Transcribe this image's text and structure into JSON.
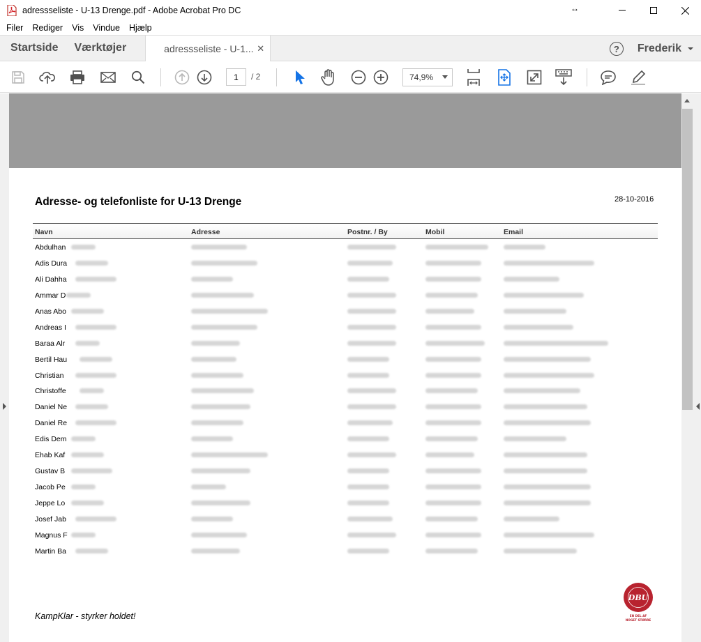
{
  "window": {
    "title": "adressseliste - U-13 Drenge.pdf - Adobe Acrobat Pro DC"
  },
  "menu": [
    "Filer",
    "Rediger",
    "Vis",
    "Vindue",
    "Hjælp"
  ],
  "tabs": {
    "home": "Startside",
    "tools": "Værktøjer",
    "document": "adressseliste - U-1...",
    "user": "Frederik"
  },
  "toolbar": {
    "page_current": "1",
    "page_total": "/ 2",
    "zoom": "74,9%"
  },
  "document": {
    "title": "Adresse- og telefonliste for U-13 Drenge",
    "date": "28-10-2016",
    "columns": [
      "Navn",
      "Adresse",
      "Postnr. / By",
      "Mobil",
      "Email"
    ],
    "rows": [
      "Abdulhan",
      "Adis Dura",
      "Ali Dahha",
      "Ammar D",
      "Anas Abo",
      "Andreas I",
      "Baraa Alr",
      "Bertil Hau",
      "Christian",
      "Christoffe",
      "Daniel Ne",
      "Daniel Re",
      "Edis Dem",
      "Ehab Kaf",
      "Gustav B",
      "Jacob Pe",
      "Jeppe Lo",
      "Josef Jab",
      "Magnus F",
      "Martin Ba"
    ],
    "footer": "KampKlar - styrker holdet!",
    "logo_text": "DBU",
    "logo_caption": "EN DEL AF NOGET STØRRE"
  },
  "colors": {
    "accent": "#1473e6",
    "band": "#9a9a9a"
  }
}
